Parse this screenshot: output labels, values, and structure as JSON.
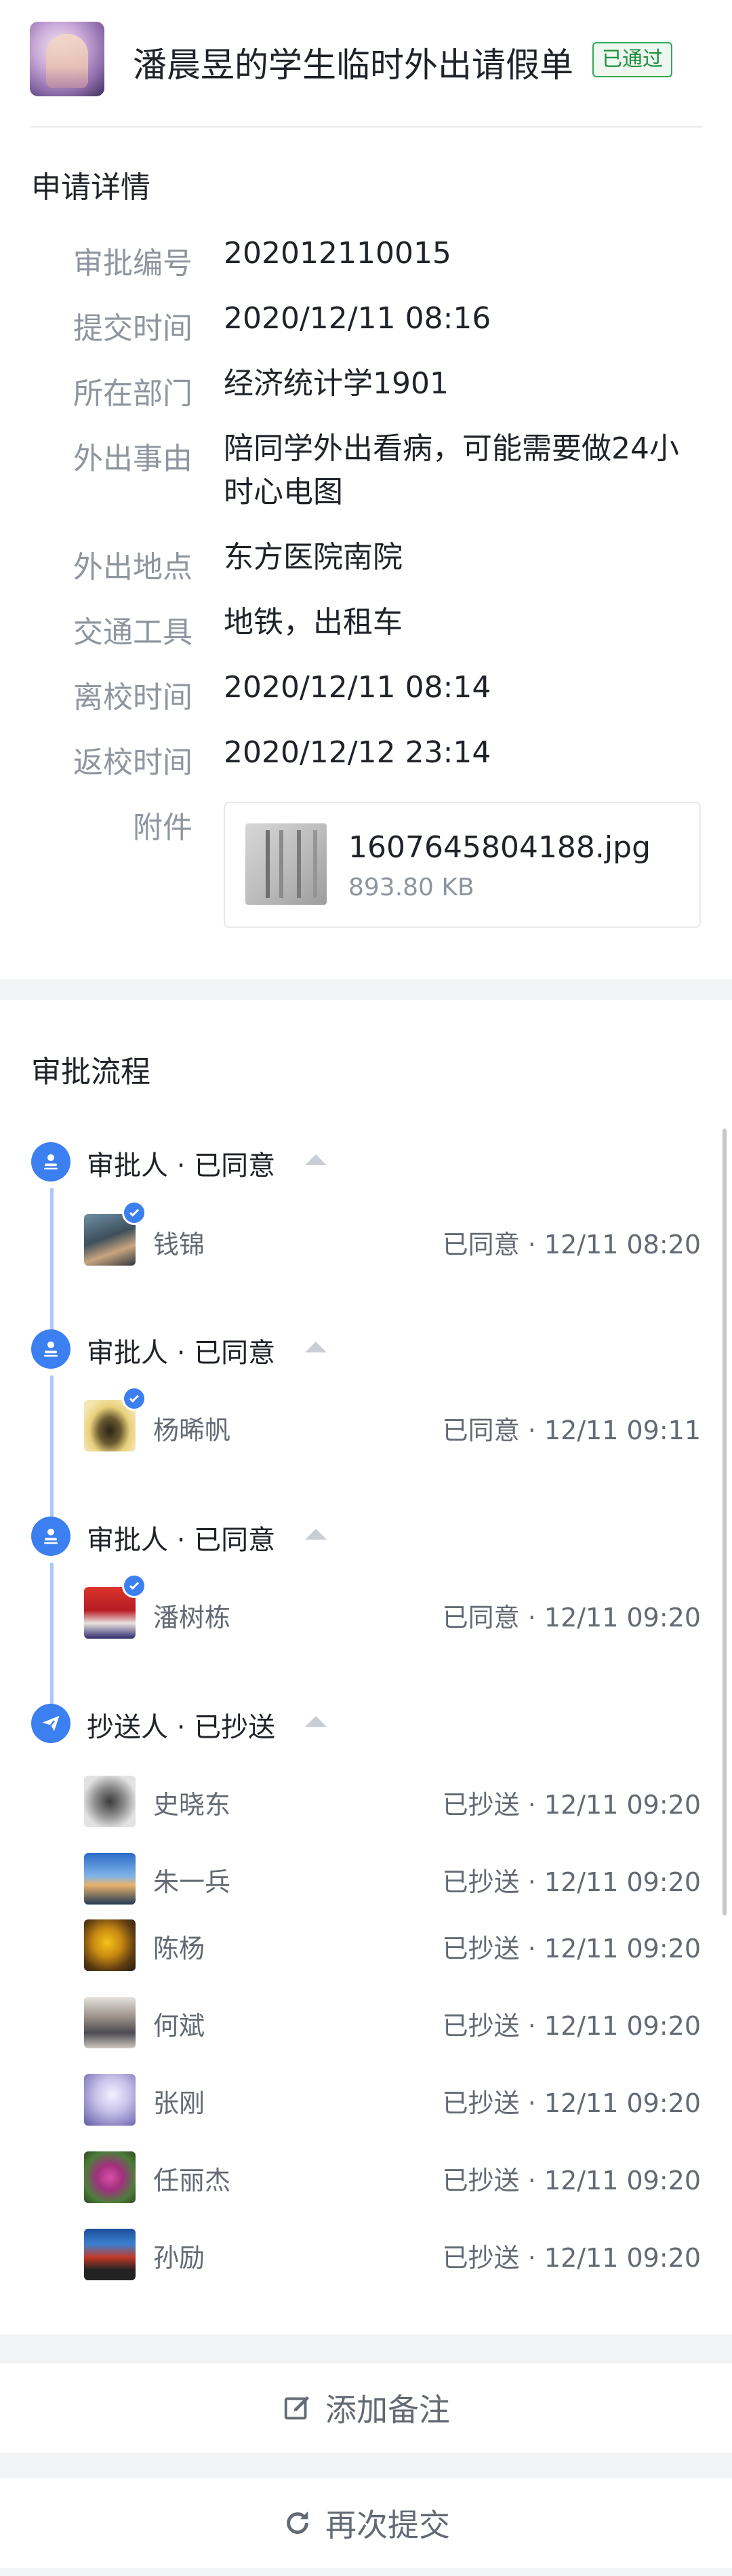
{
  "header": {
    "title": "潘晨昱的学生临时外出请假单",
    "status_badge": "已通过",
    "badge_color": "#34a853"
  },
  "details": {
    "section_title": "申请详情",
    "fields": [
      {
        "label": "审批编号",
        "value": "202012110015"
      },
      {
        "label": "提交时间",
        "value": "2020/12/11 08:16"
      },
      {
        "label": "所在部门",
        "value": "经济统计学1901"
      },
      {
        "label": "外出事由",
        "value": "陪同学外出看病，可能需要做24小时心电图"
      },
      {
        "label": "外出地点",
        "value": "东方医院南院"
      },
      {
        "label": "交通工具",
        "value": "地铁，出租车"
      },
      {
        "label": "离校时间",
        "value": "2020/12/11 08:14"
      },
      {
        "label": "返校时间",
        "value": "2020/12/12 23:14"
      }
    ],
    "attachment": {
      "label": "附件",
      "file_name": "1607645804188.jpg",
      "file_size": "893.80 KB"
    }
  },
  "flow": {
    "section_title": "审批流程",
    "accent_color": "#3b7ff0",
    "approvers": [
      {
        "node_title": "审批人 · 已同意",
        "icon": "approver-icon",
        "name": "钱锦",
        "status": "已同意 · 12/11 08:20"
      },
      {
        "node_title": "审批人 · 已同意",
        "icon": "approver-icon",
        "name": "杨晞帆",
        "status": "已同意 · 12/11 09:11"
      },
      {
        "node_title": "审批人 · 已同意",
        "icon": "approver-icon",
        "name": "潘树栋",
        "status": "已同意 · 12/11 09:20"
      }
    ],
    "cc": {
      "node_title": "抄送人 · 已抄送",
      "icon": "send-icon",
      "people": [
        {
          "name": "史晓东",
          "status": "已抄送 · 12/11 09:20"
        },
        {
          "name": "朱一兵",
          "status": "已抄送 · 12/11 09:20"
        },
        {
          "name": "陈杨",
          "status": "已抄送 · 12/11 09:20"
        },
        {
          "name": "何斌",
          "status": "已抄送 · 12/11 09:20"
        },
        {
          "name": "张刚",
          "status": "已抄送 · 12/11 09:20"
        },
        {
          "name": "任丽杰",
          "status": "已抄送 · 12/11 09:20"
        },
        {
          "name": "孙励",
          "status": "已抄送 · 12/11 09:20"
        }
      ]
    }
  },
  "actions": {
    "add_note": "添加备注",
    "resubmit": "再次提交"
  }
}
